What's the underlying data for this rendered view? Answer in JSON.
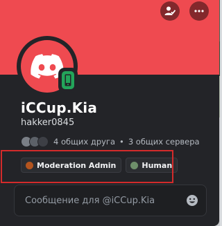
{
  "profile": {
    "display_name": "iCCup.Kia",
    "username": "hakker0845",
    "banner_color": "#ef4a50",
    "avatar_icon": "discord-logo-icon",
    "status_icon": "mobile-online-icon",
    "status_color": "#23a55a"
  },
  "header_buttons": {
    "add_friend_icon": "add-friend-icon",
    "more_icon": "more-icon"
  },
  "mutuals": {
    "friends": "4 общих друга",
    "separator": "•",
    "servers": "3 общих сервера"
  },
  "roles": [
    {
      "name": "Moderation Admin",
      "color": "#b3541e"
    },
    {
      "name": "Human",
      "color": "#6e8f6a"
    }
  ],
  "message": {
    "placeholder": "Сообщение для @iCCup.Kia",
    "emoji_icon": "emoji-icon"
  },
  "annotation": {
    "highlight_color": "#d42b2b"
  }
}
